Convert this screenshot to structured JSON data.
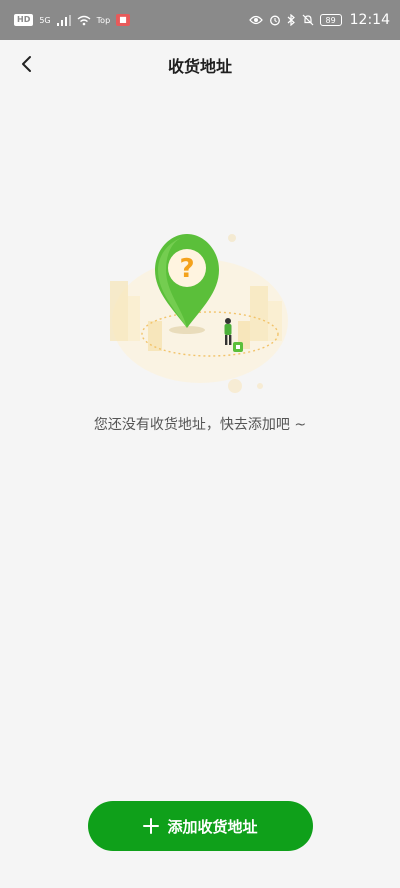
{
  "status_bar": {
    "hd": "HD",
    "signal_5g": "5G",
    "top_label": "Top",
    "battery": "89",
    "time": "12:14"
  },
  "header": {
    "title": "收货地址"
  },
  "empty_state": {
    "illustration_icon": "location-pin-question-icon",
    "message": "您还没有收货地址，快去添加吧 ~"
  },
  "footer": {
    "add_button_label": "添加收货地址",
    "add_icon": "plus-icon"
  },
  "colors": {
    "accent": "#0fa01a",
    "pin_green": "#5bbf3a",
    "question_orange": "#f4a21c",
    "status_bar": "#8a8a8a"
  }
}
